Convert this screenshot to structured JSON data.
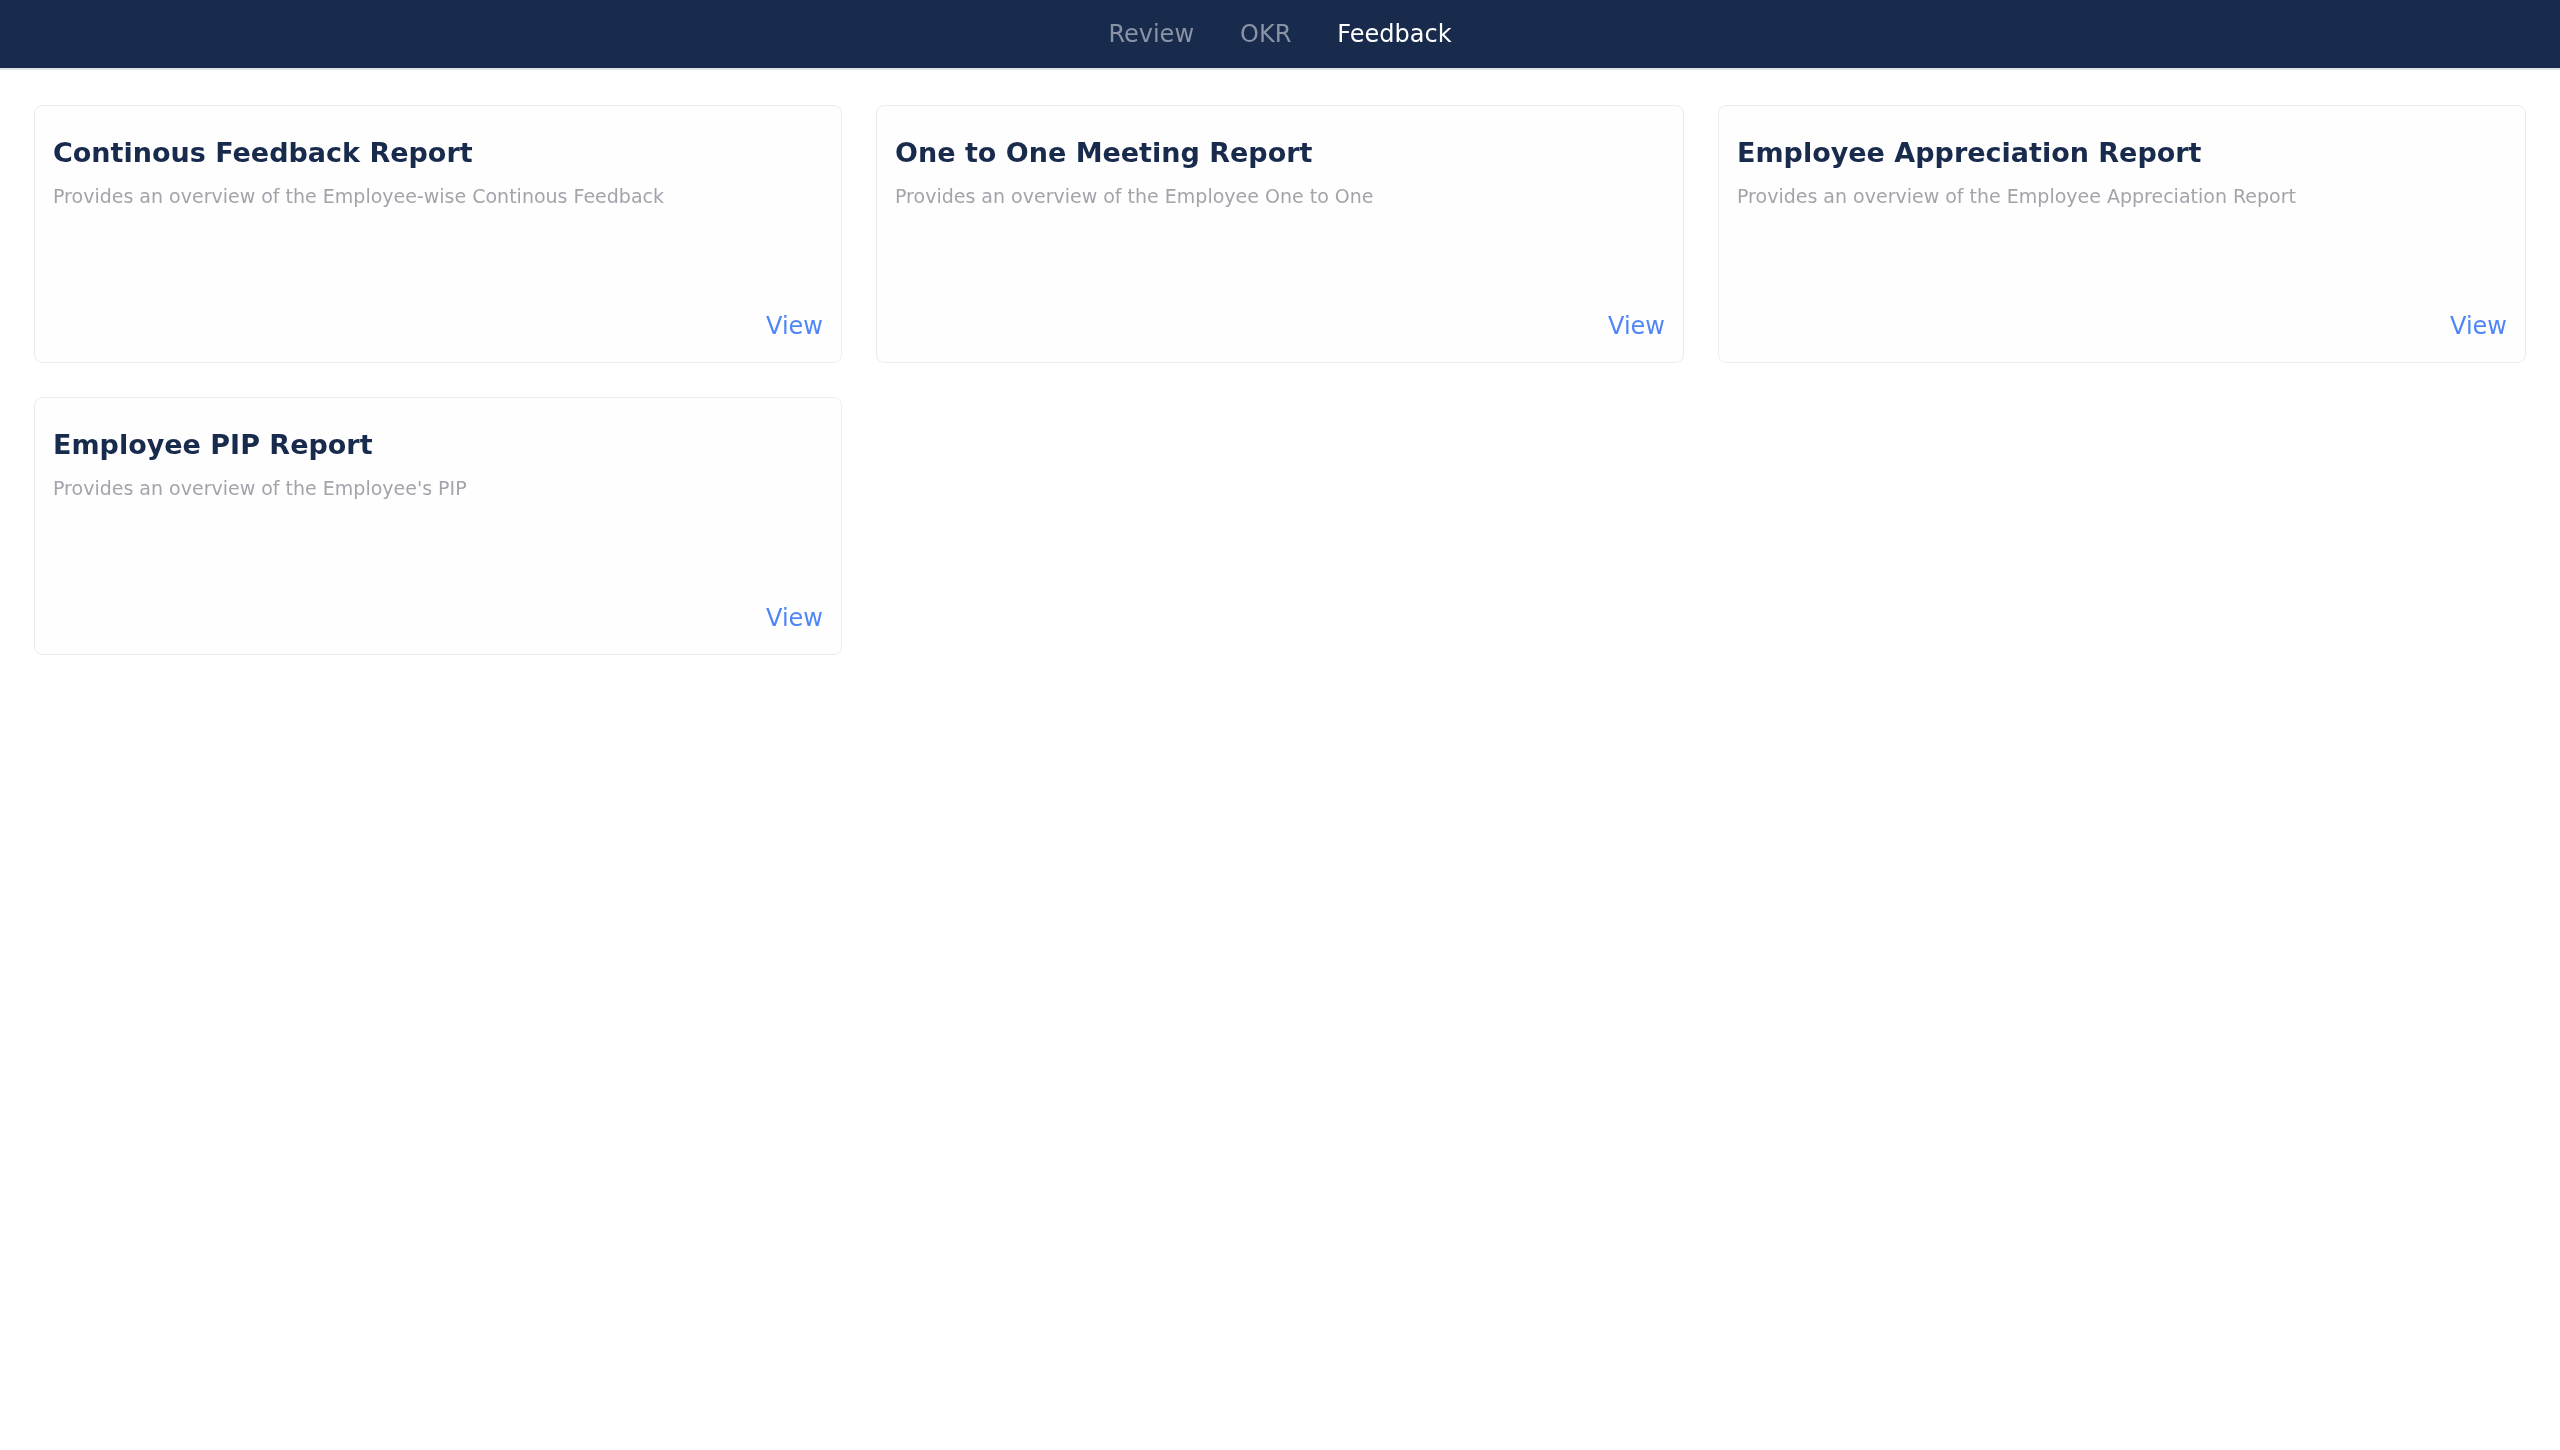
{
  "nav": {
    "tabs": [
      {
        "label": "Review",
        "selected": false
      },
      {
        "label": "OKR",
        "selected": false
      },
      {
        "label": "Feedback",
        "selected": true
      }
    ]
  },
  "reports": [
    {
      "title": "Continous Feedback Report",
      "description": "Provides an overview of the Employee-wise Continous Feedback",
      "action": "View"
    },
    {
      "title": "One to One Meeting Report",
      "description": "Provides an overview of the Employee One to One",
      "action": "View"
    },
    {
      "title": "Employee Appreciation Report",
      "description": "Provides an overview of the Employee Appreciation Report",
      "action": "View"
    },
    {
      "title": "Employee PIP Report",
      "description": "Provides an overview of the Employee's PIP",
      "action": "View"
    }
  ]
}
